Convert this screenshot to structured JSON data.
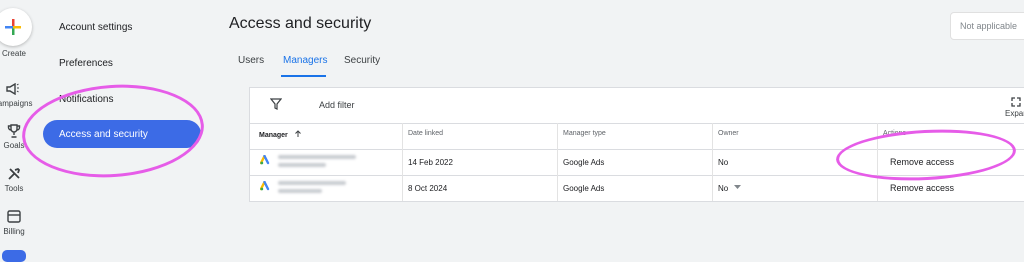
{
  "rail": {
    "create_label": "Create",
    "campaigns_label": "Campaigns",
    "goals_label": "Goals",
    "tools_label": "Tools",
    "billing_label": "Billing",
    "icons": [
      "plus-multicolor-icon",
      "megaphone-icon",
      "trophy-icon",
      "tools-icon",
      "billing-icon"
    ]
  },
  "nav": {
    "items": [
      "Account settings",
      "Preferences",
      "Notifications",
      "Access and security"
    ],
    "active_index": 3
  },
  "header": {
    "title": "Access and security",
    "status_box": "Not applicable"
  },
  "tabs": {
    "items": [
      "Users",
      "Managers",
      "Security"
    ],
    "active": "Managers"
  },
  "toolbar": {
    "add_filter": "Add filter",
    "expand_label": "Expand"
  },
  "table": {
    "columns": [
      "Manager",
      "Date linked",
      "Manager type",
      "Owner",
      "Actions"
    ],
    "sort_icon": "arrow-up-icon",
    "rows": [
      {
        "date_linked": "14 Feb 2022",
        "manager_type": "Google Ads",
        "owner": "No",
        "action": "Remove access"
      },
      {
        "date_linked": "8 Oct 2024",
        "manager_type": "Google Ads",
        "owner": "No",
        "action": "Remove access"
      }
    ]
  },
  "colors": {
    "accent": "#3c6be6",
    "link": "#1a73e8",
    "annotation": "#e65ce8"
  }
}
